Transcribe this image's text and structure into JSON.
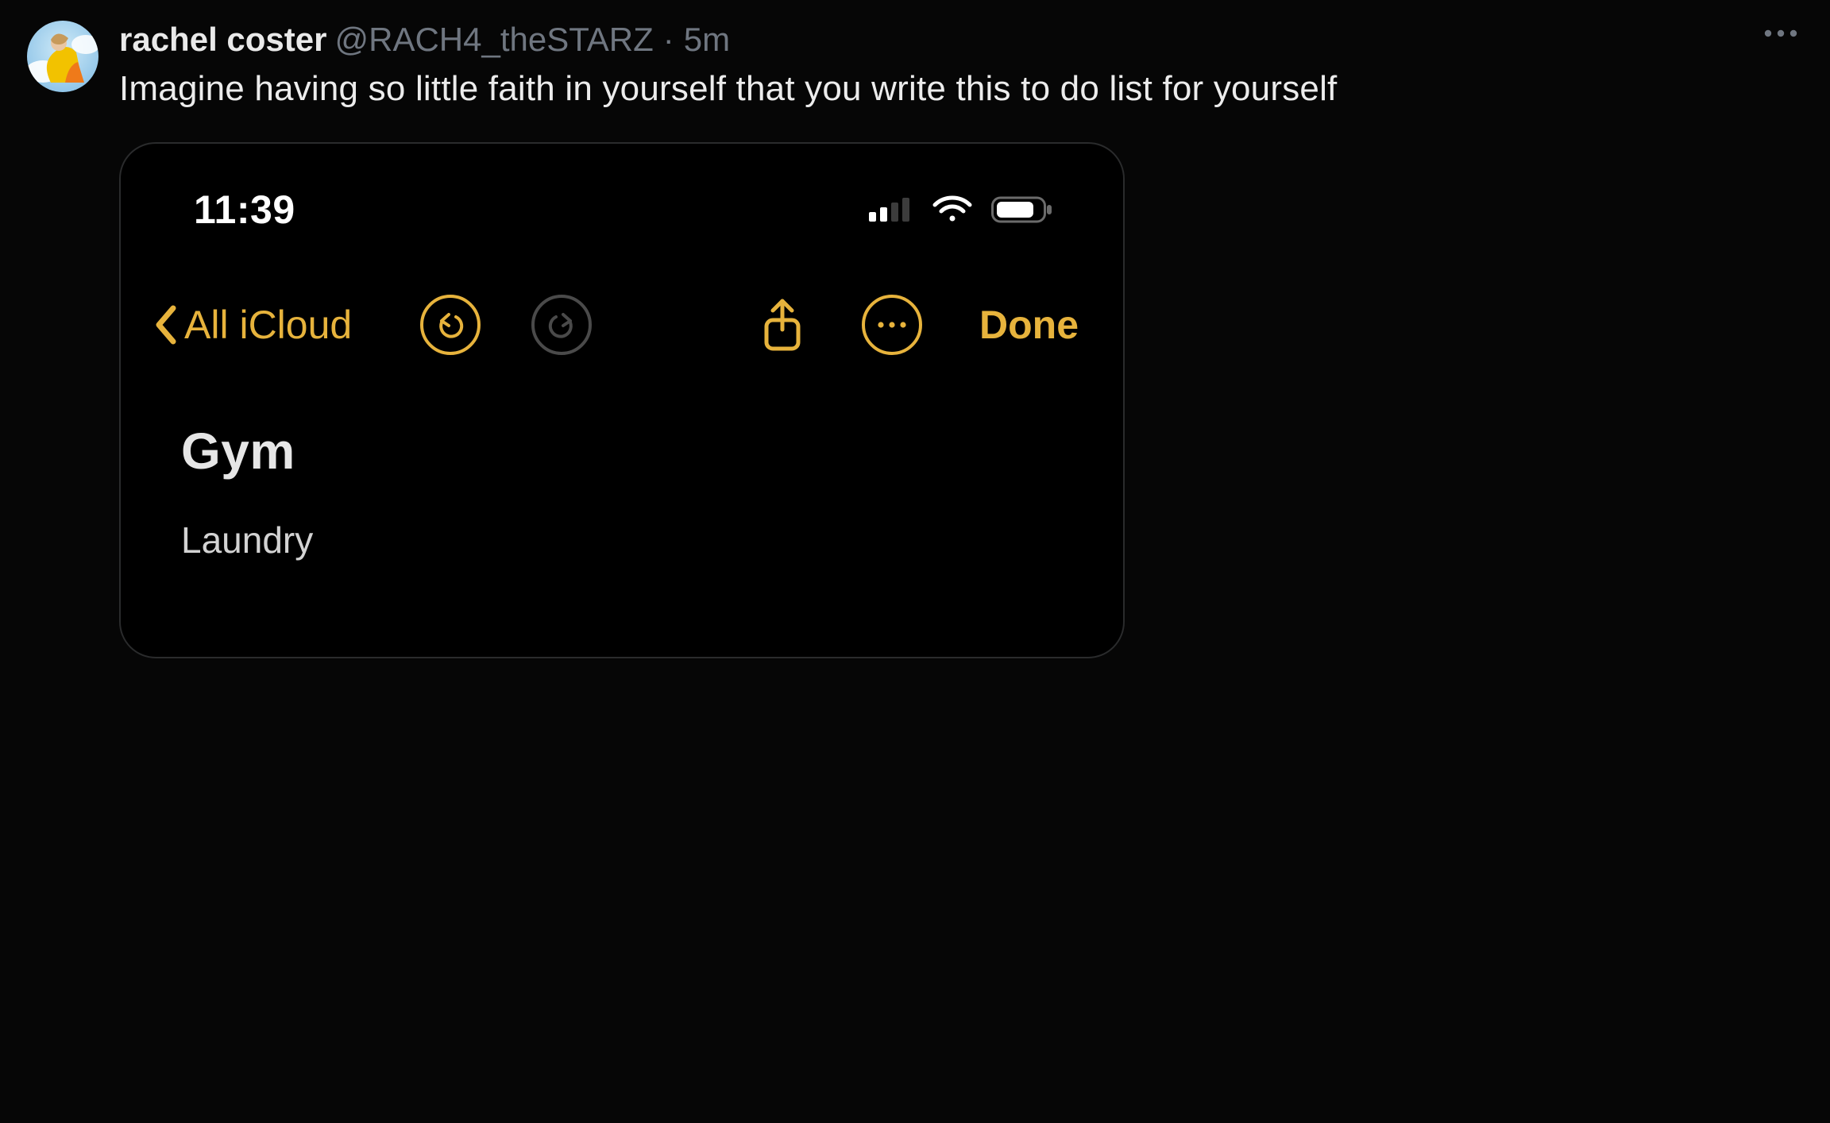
{
  "tweet": {
    "display_name": "rachel coster",
    "handle": "@RACH4_theSTARZ",
    "separator": "·",
    "timestamp": "5m",
    "text": "Imagine having so little faith in yourself that you write this to do list for yourself"
  },
  "attachment": {
    "status_bar": {
      "time": "11:39"
    },
    "toolbar": {
      "back_label": "All iCloud",
      "done_label": "Done"
    },
    "note": {
      "title": "Gym",
      "lines": [
        "Laundry"
      ]
    }
  },
  "colors": {
    "accent": "#e7b33c"
  }
}
